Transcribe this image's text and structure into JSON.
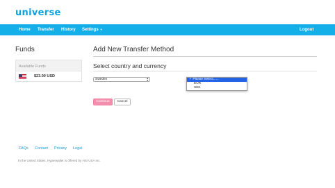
{
  "brand": {
    "logo_text": "universe",
    "accent": "#14aee8"
  },
  "nav": {
    "items": [
      "Home",
      "Transfer",
      "History",
      "Settings"
    ],
    "settings_caret": "▼",
    "logout": "Logout"
  },
  "funds": {
    "title": "Funds",
    "available_label": "Available Funds",
    "amount": "$23.00 USD",
    "flag_icon": "us-flag-icon"
  },
  "main": {
    "title": "Add New Transfer Method",
    "subtitle": "Select country and currency",
    "country_select": {
      "value": "Sweden"
    },
    "currency_dropdown": {
      "options": [
        "Please Select......",
        "EUR",
        "SEK"
      ],
      "selected_index": 0,
      "check_mark": "✓"
    },
    "continue_label": "Continue",
    "cancel_label": "Cancel"
  },
  "footer": {
    "links": [
      "FAQs",
      "Contact",
      "Privacy",
      "Legal"
    ],
    "note": "In the United States, Hyperwallet is offered by HSI USA Inc."
  }
}
